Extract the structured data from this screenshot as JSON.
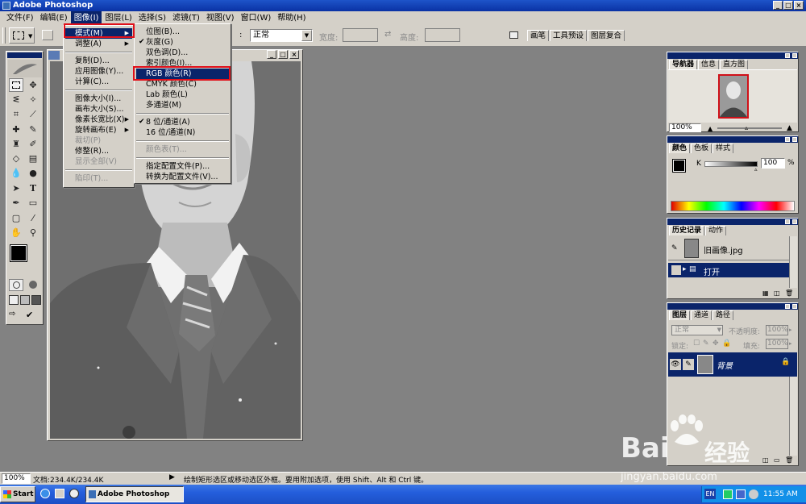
{
  "window": {
    "title": "Adobe Photoshop"
  },
  "menubar": [
    "文件(F)",
    "编辑(E)",
    "图像(I)",
    "图层(L)",
    "选择(S)",
    "滤镜(T)",
    "视图(V)",
    "窗口(W)",
    "帮助(H)"
  ],
  "options": {
    "mode_value": "正常",
    "width_label": "宽度:",
    "height_label": "高度:",
    "palette_tabs": [
      "画笔",
      "工具预设",
      "图层复合"
    ]
  },
  "image_menu": {
    "items": [
      {
        "label": "模式(M)",
        "arrow": true,
        "selected": true
      },
      {
        "label": "调整(A)",
        "arrow": true
      },
      {
        "sep": true
      },
      {
        "label": "复制(D)..."
      },
      {
        "label": "应用图像(Y)..."
      },
      {
        "label": "计算(C)..."
      },
      {
        "sep": true
      },
      {
        "label": "图像大小(I)..."
      },
      {
        "label": "画布大小(S)..."
      },
      {
        "label": "像素长宽比(X)",
        "arrow": true
      },
      {
        "label": "旋转画布(E)",
        "arrow": true
      },
      {
        "label": "裁切(P)",
        "disabled": true
      },
      {
        "label": "修整(R)..."
      },
      {
        "label": "显示全部(V)",
        "disabled": true
      },
      {
        "sep": true
      },
      {
        "label": "陷印(T)...",
        "disabled": true
      }
    ]
  },
  "mode_menu": {
    "items": [
      {
        "label": "位图(B)..."
      },
      {
        "label": "灰度(G)",
        "checked": true
      },
      {
        "label": "双色调(D)..."
      },
      {
        "label": "索引颜色(I)..."
      },
      {
        "label": "RGB 颜色(R)",
        "selected": true
      },
      {
        "label": "CMYK 颜色(C)"
      },
      {
        "label": "Lab 颜色(L)"
      },
      {
        "label": "多通道(M)"
      },
      {
        "sep": true
      },
      {
        "label": "8 位/通道(A)",
        "checked": true
      },
      {
        "label": "16 位/通道(N)"
      },
      {
        "sep": true
      },
      {
        "label": "颜色表(T)...",
        "disabled": true
      },
      {
        "sep": true
      },
      {
        "label": "指定配置文件(P)..."
      },
      {
        "label": "转换为配置文件(V)..."
      }
    ]
  },
  "navigator": {
    "tabs": [
      "导航器",
      "信息",
      "直方图"
    ],
    "zoom": "100%"
  },
  "color": {
    "tabs": [
      "颜色",
      "色板",
      "样式"
    ],
    "channel": "K",
    "value": "100",
    "unit": "%"
  },
  "history": {
    "tabs": [
      "历史记录",
      "动作"
    ],
    "snapshot": "旧画像.jpg",
    "state": "打开"
  },
  "layers": {
    "tabs": [
      "图层",
      "通道",
      "路径"
    ],
    "blend": "正常",
    "opacity_label": "不透明度:",
    "opacity": "100%",
    "lock_label": "锁定:",
    "fill_label": "填充:",
    "fill": "100%",
    "layer_name": "背景"
  },
  "status": {
    "zoom": "100%",
    "doc": "文档:234.4K/234.4K",
    "hint": "绘制矩形选区或移动选区外框。要用附加选项，使用 Shift、Alt 和 Ctrl 键。"
  },
  "taskbar": {
    "start": "Start",
    "app": "Adobe Photoshop",
    "lang": "EN",
    "time": "11:55 AM"
  },
  "watermark": {
    "brand_a": "Bai",
    "brand_b": "经验",
    "url": "jingyan.baidu.com"
  }
}
